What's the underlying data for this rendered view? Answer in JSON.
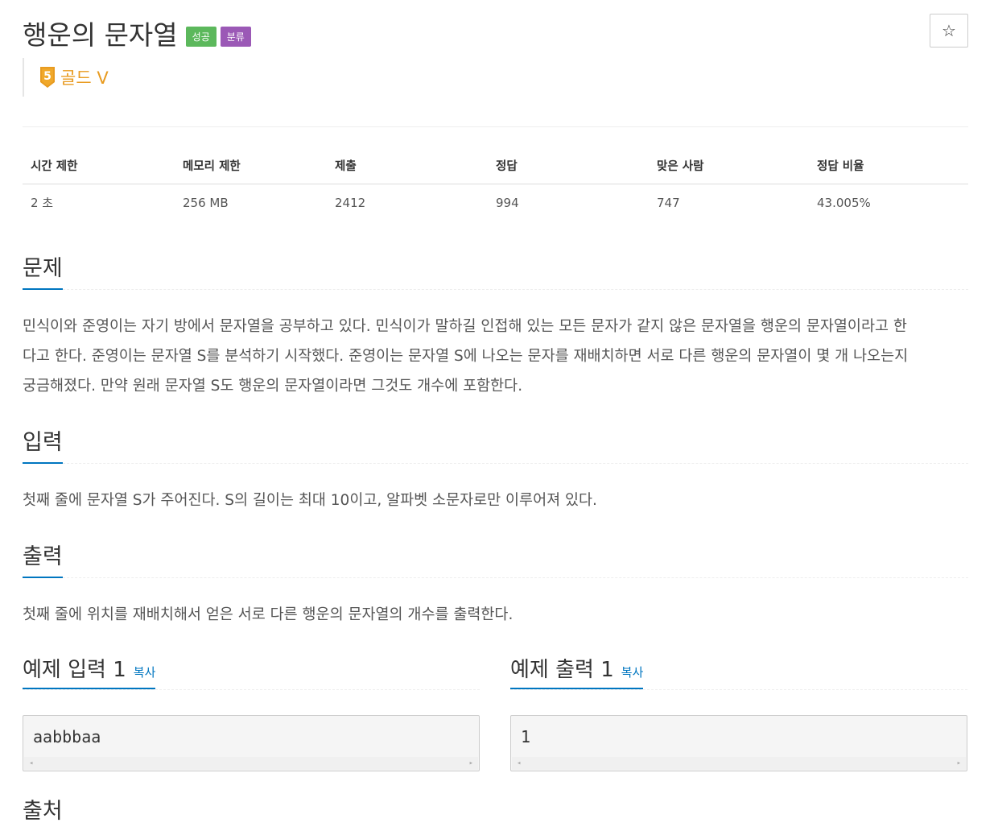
{
  "problem": {
    "title": "행운의 문자열",
    "badges": {
      "success": "성공",
      "category": "분류"
    },
    "star_icon": "star-outline-icon",
    "tier": {
      "number": "5",
      "label": "골드 V",
      "color": "#e89b20"
    }
  },
  "info_table": {
    "headers": [
      "시간 제한",
      "메모리 제한",
      "제출",
      "정답",
      "맞은 사람",
      "정답 비율"
    ],
    "values": [
      "2 초",
      "256 MB",
      "2412",
      "994",
      "747",
      "43.005%"
    ]
  },
  "sections": {
    "description": {
      "title": "문제",
      "lines": [
        "민식이와 준영이는 자기 방에서 문자열을 공부하고 있다. 민식이가 말하길 인접해 있는 모든 문자가 같지 않은 문자열을 행운의 문자열이라고 한",
        "다고 한다. 준영이는 문자열 S를 분석하기 시작했다. 준영이는 문자열 S에 나오는 문자를 재배치하면 서로 다른 행운의 문자열이 몇 개 나오는지",
        "궁금해졌다. 만약 원래 문자열 S도 행운의 문자열이라면 그것도 개수에 포함한다."
      ]
    },
    "input": {
      "title": "입력",
      "text": "첫째 줄에 문자열 S가 주어진다. S의 길이는 최대 10이고, 알파벳 소문자로만 이루어져 있다."
    },
    "output": {
      "title": "출력",
      "text": "첫째 줄에 위치를 재배치해서 얻은 서로 다른 행운의 문자열의 개수를 출력한다."
    },
    "source": {
      "title": "출처"
    }
  },
  "samples": {
    "input": {
      "title": "예제 입력 1",
      "copy_label": "복사",
      "content": "aabbbaa"
    },
    "output": {
      "title": "예제 출력 1",
      "copy_label": "복사",
      "content": "1"
    }
  },
  "colors": {
    "accent": "#0076c0",
    "success": "#5cb85c",
    "category": "#9b59b6",
    "tier": "#e89b20"
  }
}
